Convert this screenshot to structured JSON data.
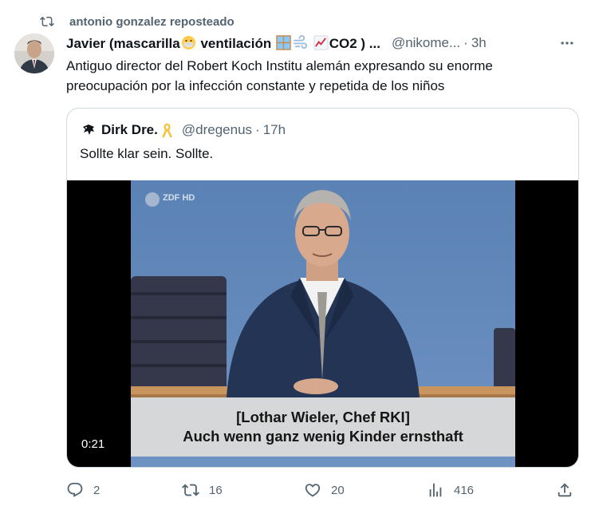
{
  "repost": {
    "label": "antonio gonzalez reposteado",
    "icon": "retweet-icon"
  },
  "tweet": {
    "author": {
      "name_part1": "Javier (mascarilla",
      "name_part2": " ventilación ",
      "name_part3": "CO2 ) ...",
      "emojis": [
        "mask-emoji",
        "window-emoji",
        "wind-emoji",
        "chart-increasing-emoji"
      ],
      "handle": "@nikome...",
      "time": "3h"
    },
    "text": "Antiguo director del Robert Koch Institu alemán expresando su enorme preocupación por la infección constante y repetida de los niños"
  },
  "quote": {
    "author": {
      "name": "Dirk Dre.",
      "handle": "@dregenus",
      "time": "17h"
    },
    "text": "Sollte klar sein. Sollte.",
    "video": {
      "channel_logo": "ZDF HD",
      "subtitle_line1": "[Lothar Wieler, Chef RKI]",
      "subtitle_line2": "Auch wenn ganz wenig Kinder ernsthaft",
      "duration": "0:21"
    }
  },
  "actions": {
    "replies": "2",
    "reposts": "16",
    "likes": "20",
    "views": "416"
  },
  "colors": {
    "text": "#0f1419",
    "muted": "#536471",
    "border": "#cfd9de"
  }
}
